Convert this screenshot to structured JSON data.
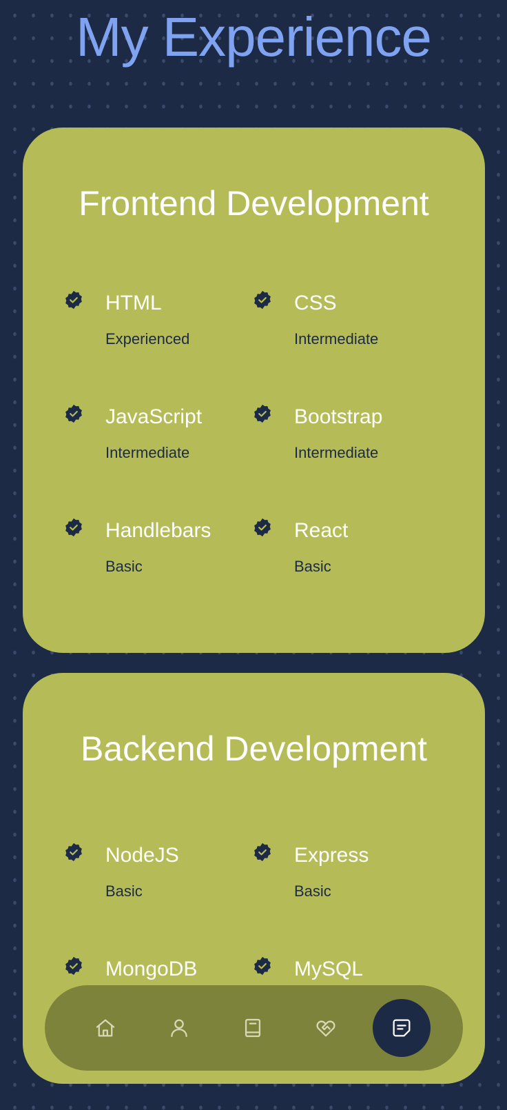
{
  "header": {
    "title": "My Experience"
  },
  "sections": [
    {
      "title": "Frontend Development",
      "skills": [
        {
          "name": "HTML",
          "level": "Experienced"
        },
        {
          "name": "CSS",
          "level": "Intermediate"
        },
        {
          "name": "JavaScript",
          "level": "Intermediate"
        },
        {
          "name": "Bootstrap",
          "level": "Intermediate"
        },
        {
          "name": "Handlebars",
          "level": "Basic"
        },
        {
          "name": "React",
          "level": "Basic"
        }
      ]
    },
    {
      "title": "Backend Development",
      "skills": [
        {
          "name": "NodeJS",
          "level": "Basic"
        },
        {
          "name": "Express",
          "level": "Basic"
        },
        {
          "name": "MongoDB",
          "level": ""
        },
        {
          "name": "MySQL",
          "level": ""
        }
      ]
    }
  ],
  "nav": {
    "items": [
      {
        "icon": "home-icon",
        "active": false
      },
      {
        "icon": "user-icon",
        "active": false
      },
      {
        "icon": "book-icon",
        "active": false
      },
      {
        "icon": "handshake-icon",
        "active": false
      },
      {
        "icon": "message-icon",
        "active": true
      }
    ]
  },
  "colors": {
    "background": "#1c2a45",
    "title": "#7fa3f0",
    "card": "#b5bc57",
    "nav": "#7e833c",
    "text_light": "#ffffff",
    "text_dark": "#1c2a45"
  }
}
